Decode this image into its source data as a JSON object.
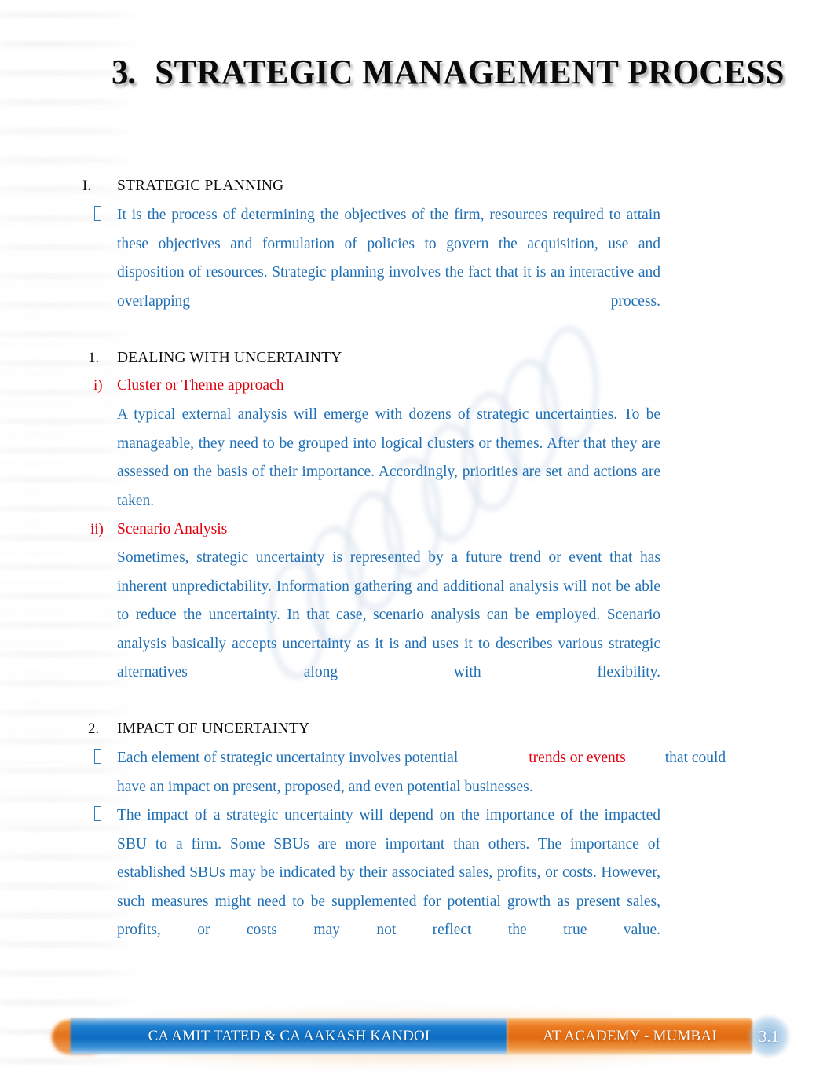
{
  "document": {
    "title_number": "3.",
    "title_text": "STRATEGIC  MANAGEMENT  PROCESS"
  },
  "colors": {
    "body_blue": "#1f6fb5",
    "accent_red": "#e3000d",
    "heading_black": "#0d0d0d",
    "footer_blue": "#0c6cc0",
    "footer_orange": "#e06a10"
  },
  "sections": {
    "section_I": {
      "marker": "I.",
      "heading": "STRATEGIC PLANNING",
      "bullet_1": "It is the process of determining the objectives of the firm, resources required to attain these objectives and formulation of policies to govern the acquisition, use and disposition of resources. Strategic planning involves the fact that it is an interactive and overlapping process."
    },
    "section_1": {
      "marker": "1.",
      "heading": "DEALING WITH UNCERTAINTY",
      "items": [
        {
          "marker": "i)",
          "subheading": "Cluster or Theme approach",
          "body": "A typical external analysis will emerge with dozens of strategic uncertainties. To be manageable, they need to be grouped into logical clusters or themes. After that they are assessed on the basis of their importance. Accordingly, priorities are set and actions are taken."
        },
        {
          "marker": "ii)",
          "subheading": "Scenario Analysis",
          "body": "Sometimes, strategic uncertainty is represented by a future trend or event that has inherent unpredictability. Information gathering and additional analysis will not be able to reduce the uncertainty. In that case, scenario analysis can be employed. Scenario analysis basically accepts uncertainty as it is and uses it to describes various strategic alternatives along with flexibility."
        }
      ]
    },
    "section_2": {
      "marker": "2.",
      "heading": "IMPACT OF UNCERTAINTY",
      "bullet_1_part_a": "Each element of strategic uncertainty involves potential",
      "bullet_1_highlight": "trends or events",
      "bullet_1_part_b": "that could",
      "bullet_1_line2": "have an impact on present, proposed, and even potential businesses.",
      "bullet_2": "The impact of a strategic uncertainty will depend on the importance of the impacted SBU to a firm. Some SBUs are more important than others. The importance of established SBUs may be indicated by their associated sales, profits, or costs. However, such measures might need to be supplemented for potential growth as present sales, profits, or costs may not reflect the true value."
    }
  },
  "footer": {
    "authors": "CA AMIT TATED & CA AAKASH KANDOI",
    "academy": "AT ACADEMY - MUMBAI",
    "page_number": "3.1"
  }
}
